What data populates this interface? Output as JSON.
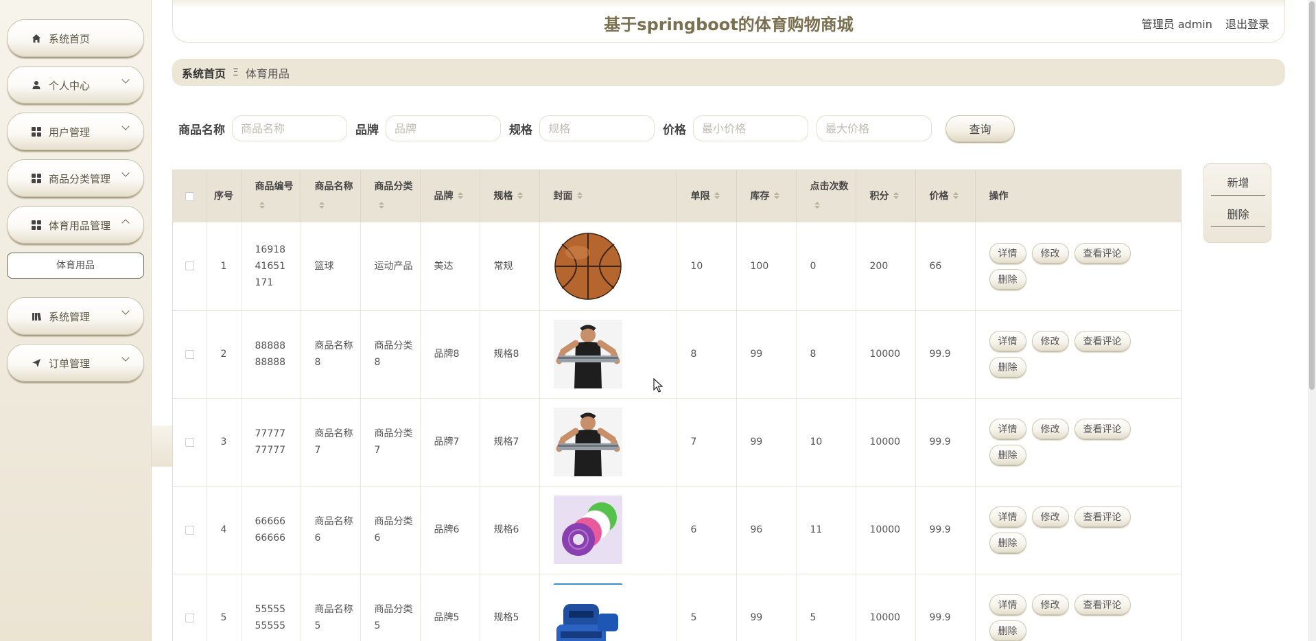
{
  "app": {
    "title": "基于springboot的体育购物商城",
    "user_label": "管理员 admin",
    "logout": "退出登录"
  },
  "sidebar": {
    "items": [
      {
        "label": "系统首页",
        "icon": "home-icon",
        "expandable": false
      },
      {
        "label": "个人中心",
        "icon": "user-icon",
        "expandable": true
      },
      {
        "label": "用户管理",
        "icon": "grid-icon",
        "expandable": true
      },
      {
        "label": "商品分类管理",
        "icon": "grid-icon",
        "expandable": true
      },
      {
        "label": "体育用品管理",
        "icon": "grid-icon",
        "expandable": true,
        "expanded": true
      },
      {
        "label": "系统管理",
        "icon": "book-icon",
        "expandable": true
      },
      {
        "label": "订单管理",
        "icon": "send-icon",
        "expandable": true
      }
    ],
    "sub_item": "体育用品"
  },
  "breadcrumb": {
    "home": "系统首页",
    "separator": "Ξ",
    "current": "体育用品"
  },
  "search": {
    "name_label": "商品名称",
    "name_placeholder": "商品名称",
    "brand_label": "品牌",
    "brand_placeholder": "品牌",
    "spec_label": "规格",
    "spec_placeholder": "规格",
    "price_label": "价格",
    "min_price_placeholder": "最小价格",
    "max_price_placeholder": "最大价格",
    "query_button": "查询"
  },
  "panel": {
    "add": "新增",
    "delete": "删除"
  },
  "table": {
    "headers": {
      "index": "序号",
      "code": "商品编号",
      "name": "商品名称",
      "category": "商品分类",
      "brand": "品牌",
      "spec": "规格",
      "cover": "封面",
      "limit": "单限",
      "stock": "库存",
      "clicks": "点击次数",
      "points": "积分",
      "price": "价格",
      "actions": "操作"
    },
    "actions": {
      "detail": "详情",
      "edit": "修改",
      "comments": "查看评论",
      "delete": "删除"
    },
    "rows": [
      {
        "index": "1",
        "code": "1691841651171",
        "name": "篮球",
        "category": "运动产品",
        "brand": "美达",
        "spec": "常规",
        "cover": "basketball",
        "limit": "10",
        "stock": "100",
        "clicks": "0",
        "points": "200",
        "price": "66"
      },
      {
        "index": "2",
        "code": "8888888888",
        "name": "商品名称8",
        "category": "商品分类8",
        "brand": "品牌8",
        "spec": "规格8",
        "cover": "resistance-band",
        "limit": "8",
        "stock": "99",
        "clicks": "8",
        "points": "10000",
        "price": "99.9"
      },
      {
        "index": "3",
        "code": "7777777777",
        "name": "商品名称7",
        "category": "商品分类7",
        "brand": "品牌7",
        "spec": "规格7",
        "cover": "resistance-band",
        "limit": "7",
        "stock": "99",
        "clicks": "10",
        "points": "10000",
        "price": "99.9"
      },
      {
        "index": "4",
        "code": "6666666666",
        "name": "商品名称6",
        "category": "商品分类6",
        "brand": "品牌6",
        "spec": "规格6",
        "cover": "twist-disc",
        "limit": "6",
        "stock": "96",
        "clicks": "11",
        "points": "10000",
        "price": "99.9"
      },
      {
        "index": "5",
        "code": "5555555555",
        "name": "商品名称5",
        "category": "商品分类5",
        "brand": "品牌5",
        "spec": "规格5",
        "cover": "weights",
        "limit": "5",
        "stock": "99",
        "clicks": "5",
        "points": "10000",
        "price": "99.9"
      }
    ]
  }
}
